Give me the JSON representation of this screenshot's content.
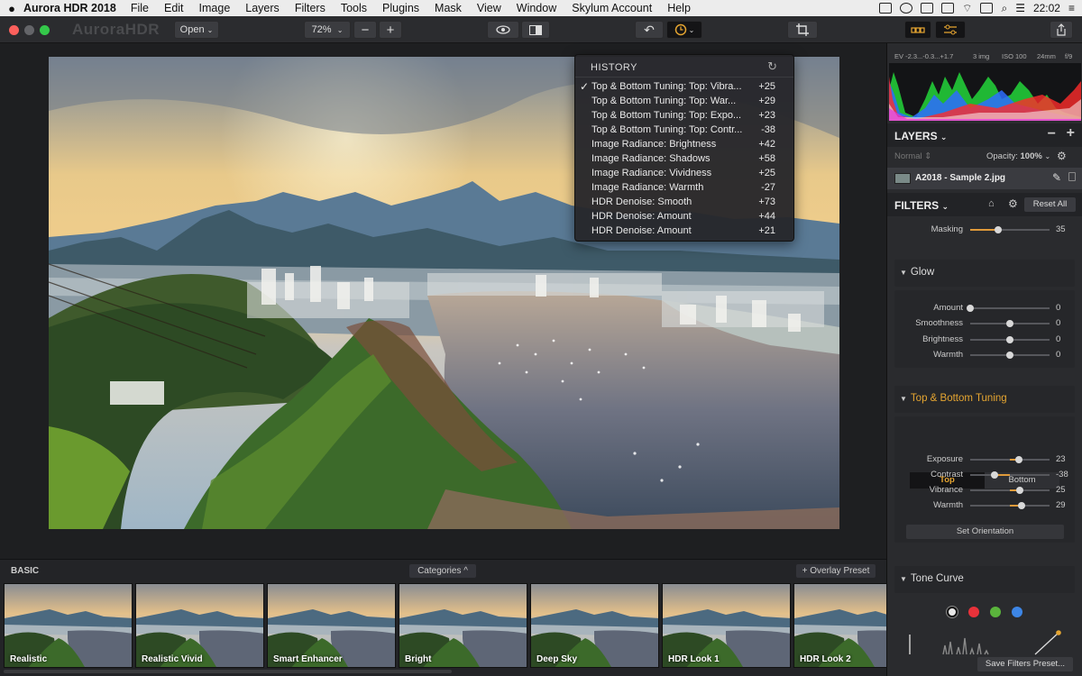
{
  "menubar": {
    "app_name": "Aurora HDR 2018",
    "items": [
      "File",
      "Edit",
      "Image",
      "Layers",
      "Filters",
      "Tools",
      "Plugins",
      "Mask",
      "View",
      "Window",
      "Skylum Account",
      "Help"
    ],
    "clock": "22:02"
  },
  "toolbar": {
    "logo": "AuroraHDR",
    "open_label": "Open",
    "zoom_label": "72%"
  },
  "history": {
    "title": "HISTORY",
    "items": [
      {
        "label": "Top & Bottom Tuning: Top: Vibra...",
        "value": "+25",
        "checked": "✓"
      },
      {
        "label": "Top & Bottom Tuning: Top: War...",
        "value": "+29"
      },
      {
        "label": "Top & Bottom Tuning: Top: Expo...",
        "value": "+23"
      },
      {
        "label": "Top & Bottom Tuning: Top: Contr...",
        "value": "-38"
      },
      {
        "label": "Image Radiance: Brightness",
        "value": "+42"
      },
      {
        "label": "Image Radiance: Shadows",
        "value": "+58"
      },
      {
        "label": "Image Radiance: Vividness",
        "value": "+25"
      },
      {
        "label": "Image Radiance: Warmth",
        "value": "-27"
      },
      {
        "label": "HDR Denoise: Smooth",
        "value": "+73"
      },
      {
        "label": "HDR Denoise: Amount",
        "value": "+44"
      },
      {
        "label": "HDR Denoise: Amount",
        "value": "+21"
      }
    ]
  },
  "presets": {
    "category": "BASIC",
    "categories_label": "Categories ^",
    "overlay_label": "+ Overlay Preset",
    "items": [
      "Realistic",
      "Realistic Vivid",
      "Smart Enhancer",
      "Bright",
      "Deep Sky",
      "HDR Look 1",
      "HDR Look 2"
    ]
  },
  "panel": {
    "ev_info": [
      "EV -2.3...-0.3...+1.7",
      "3 img",
      "ISO 100",
      "24mm",
      "f/9"
    ],
    "layers_title": "LAYERS",
    "blend_mode": "Normal",
    "opacity_label": "Opacity:",
    "opacity_value": "100%",
    "layer_name": "A2018 - Sample 2.jpg",
    "filters_title": "FILTERS",
    "reset_all": "Reset All",
    "masking": {
      "label": "Masking",
      "value": "35",
      "level": 0.35
    },
    "glow": {
      "title": "Glow",
      "sliders": [
        {
          "label": "Amount",
          "value": "0",
          "level": 0
        },
        {
          "label": "Smoothness",
          "value": "0",
          "level": 0.5
        },
        {
          "label": "Brightness",
          "value": "0",
          "level": 0.5
        },
        {
          "label": "Warmth",
          "value": "0",
          "level": 0.5
        }
      ]
    },
    "tuning": {
      "title": "Top & Bottom Tuning",
      "tab_top": "Top",
      "tab_bottom": "Bottom",
      "sliders": [
        {
          "label": "Exposure",
          "value": "23",
          "level": 0.615
        },
        {
          "label": "Contrast",
          "value": "-38",
          "level": 0.31
        },
        {
          "label": "Vibrance",
          "value": "25",
          "level": 0.625
        },
        {
          "label": "Warmth",
          "value": "29",
          "level": 0.645
        }
      ],
      "set_orientation": "Set Orientation"
    },
    "tone_curve": {
      "title": "Tone Curve",
      "channels": [
        "#e8e8e8",
        "#e8323a",
        "#5ab43c",
        "#3d86e6"
      ]
    },
    "save_filters": "Save Filters Preset..."
  },
  "colors": {
    "accent": "#e09a3a",
    "panel_bg": "#2a2b2e"
  }
}
